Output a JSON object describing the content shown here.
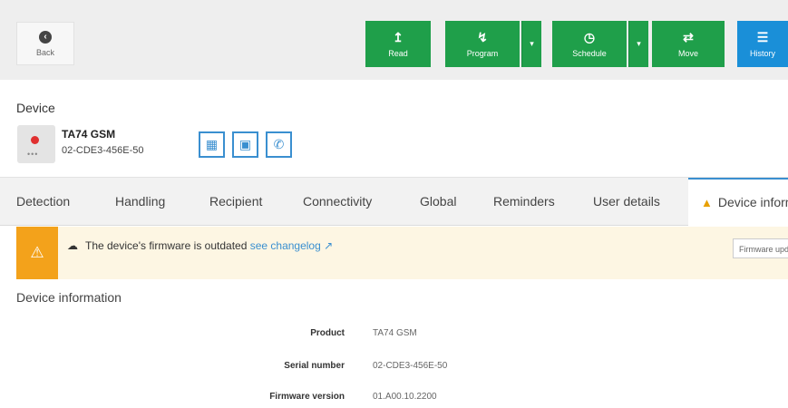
{
  "toolbar": {
    "back_label": "Back",
    "buttons": [
      {
        "label": "Read",
        "icon": "upload-icon"
      },
      {
        "label": "Program",
        "icon": "bolt-icon"
      },
      {
        "label": "Schedule",
        "icon": "clock-icon"
      },
      {
        "label": "Move",
        "icon": "shuffle-icon"
      },
      {
        "label": "History",
        "icon": "list-icon"
      }
    ]
  },
  "device": {
    "section_label": "Device",
    "name": "TA74 GSM",
    "serial": "02-CDE3-456E-50"
  },
  "tabs": [
    "Detection",
    "Handling",
    "Recipient",
    "Connectivity",
    "Global",
    "Reminders",
    "User details",
    "Device information"
  ],
  "alert": {
    "message": "The device's firmware is outdated",
    "link": "see changelog",
    "button": "Firmware update"
  },
  "info": {
    "title": "Device information",
    "rows": [
      {
        "label": "Product",
        "value": "TA74 GSM"
      },
      {
        "label": "Serial number",
        "value": "02-CDE3-456E-50"
      },
      {
        "label": "Firmware version",
        "value": "01.A00.10.2200"
      }
    ]
  },
  "colors": {
    "green": "#1f9f4a",
    "blue": "#1a8fd8",
    "warning": "#f3a21b",
    "accent": "#3a8fd0"
  }
}
